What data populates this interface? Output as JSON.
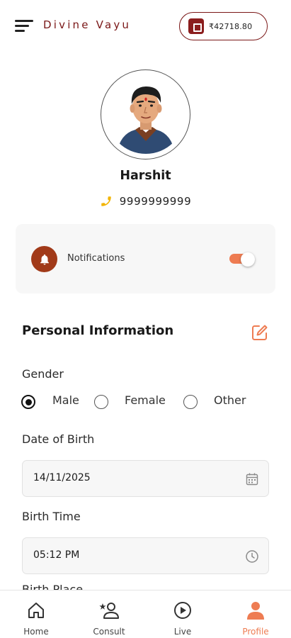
{
  "header": {
    "brand": "Divine Vayu",
    "wallet_amount": "₹42718.80",
    "icons": {
      "menu": "hamburger-menu-icon",
      "wallet": "wallet-icon"
    }
  },
  "profile": {
    "name": "Harshit",
    "phone": "9999999999"
  },
  "notifications": {
    "label": "Notifications",
    "enabled": true
  },
  "personal_info": {
    "title": "Personal Information",
    "gender_label": "Gender",
    "gender_options": [
      "Male",
      "Female",
      "Other"
    ],
    "gender_selected": "Male",
    "dob_label": "Date of Birth",
    "dob_value": "14/11/2025",
    "birth_time_label": "Birth Time",
    "birth_time_value": "05:12 PM",
    "next_label_partial": "Birth Place"
  },
  "bottom_nav": {
    "items": [
      {
        "label": "Home",
        "icon": "home-icon"
      },
      {
        "label": "Consult",
        "icon": "consult-icon"
      },
      {
        "label": "Live",
        "icon": "live-play-icon"
      },
      {
        "label": "Profile",
        "icon": "profile-icon"
      }
    ],
    "active": "Profile"
  },
  "colors": {
    "brand": "#7a1717",
    "accent": "#ee7c52",
    "bell_bg": "#a13a19",
    "phone_icon": "#f2b400"
  }
}
